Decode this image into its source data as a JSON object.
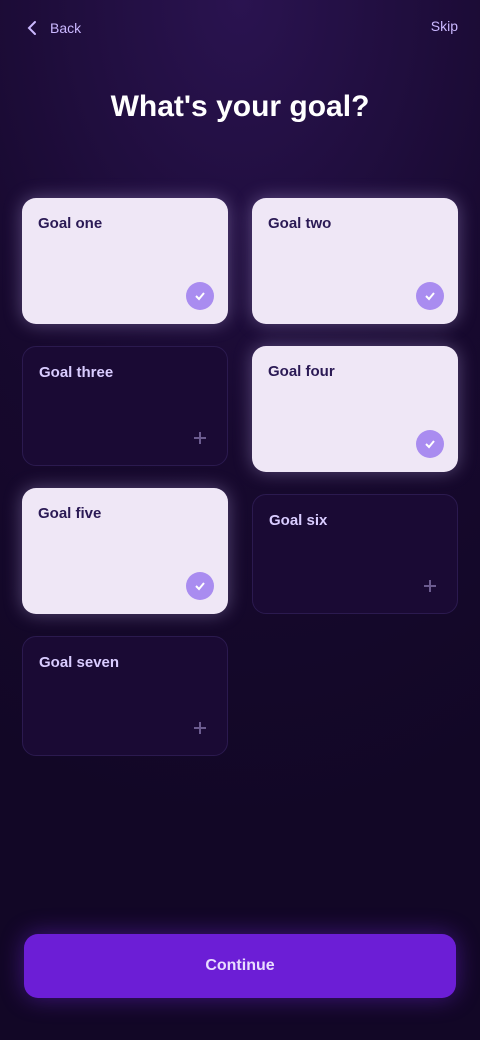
{
  "header": {
    "back_label": "Back",
    "skip_label": "Skip"
  },
  "title": "What's your goal?",
  "options": [
    {
      "label": "Goal one",
      "selected": true
    },
    {
      "label": "Goal two",
      "selected": true
    },
    {
      "label": "Goal three",
      "selected": false
    },
    {
      "label": "Goal four",
      "selected": true
    },
    {
      "label": "Goal five",
      "selected": true
    },
    {
      "label": "Goal six",
      "selected": false
    },
    {
      "label": "Goal seven",
      "selected": false
    }
  ],
  "continue_label": "Continue",
  "colors": {
    "accent": "#6c1ed6",
    "selected_card": "#efe7f6",
    "check": "#a98cf0"
  }
}
